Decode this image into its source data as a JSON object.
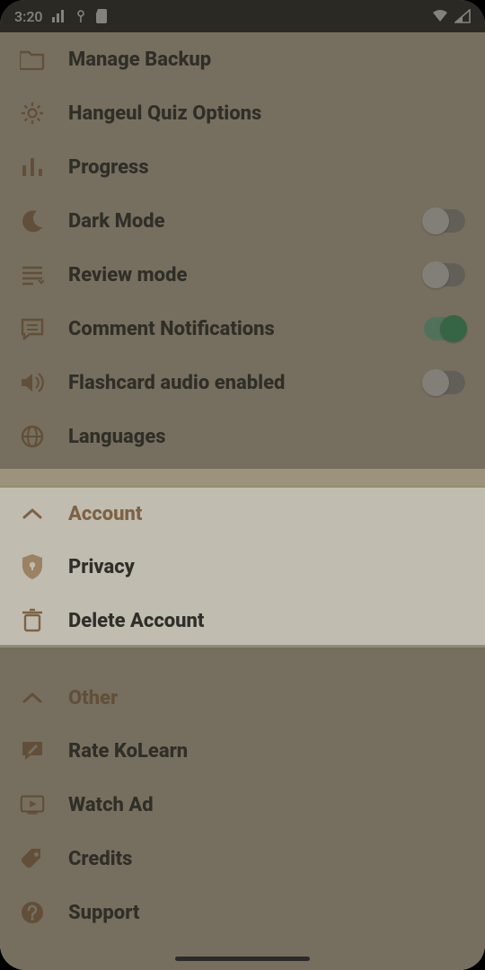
{
  "status": {
    "time": "3:20"
  },
  "settings": {
    "manage_backup": "Manage Backup",
    "hangeul_quiz": "Hangeul Quiz Options",
    "progress": "Progress",
    "dark_mode": "Dark Mode",
    "review_mode": "Review mode",
    "comment_notifications": "Comment Notifications",
    "flashcard_audio": "Flashcard audio enabled",
    "languages": "Languages"
  },
  "toggles": {
    "dark_mode": false,
    "review_mode": false,
    "comment_notifications": true,
    "flashcard_audio": false
  },
  "account": {
    "header": "Account",
    "privacy": "Privacy",
    "delete_account": "Delete Account"
  },
  "other": {
    "header": "Other",
    "rate": "Rate KoLearn",
    "watch_ad": "Watch Ad",
    "credits": "Credits",
    "support": "Support"
  },
  "colors": {
    "accent": "#9c7650",
    "toggle_on": "#3aa76d"
  }
}
